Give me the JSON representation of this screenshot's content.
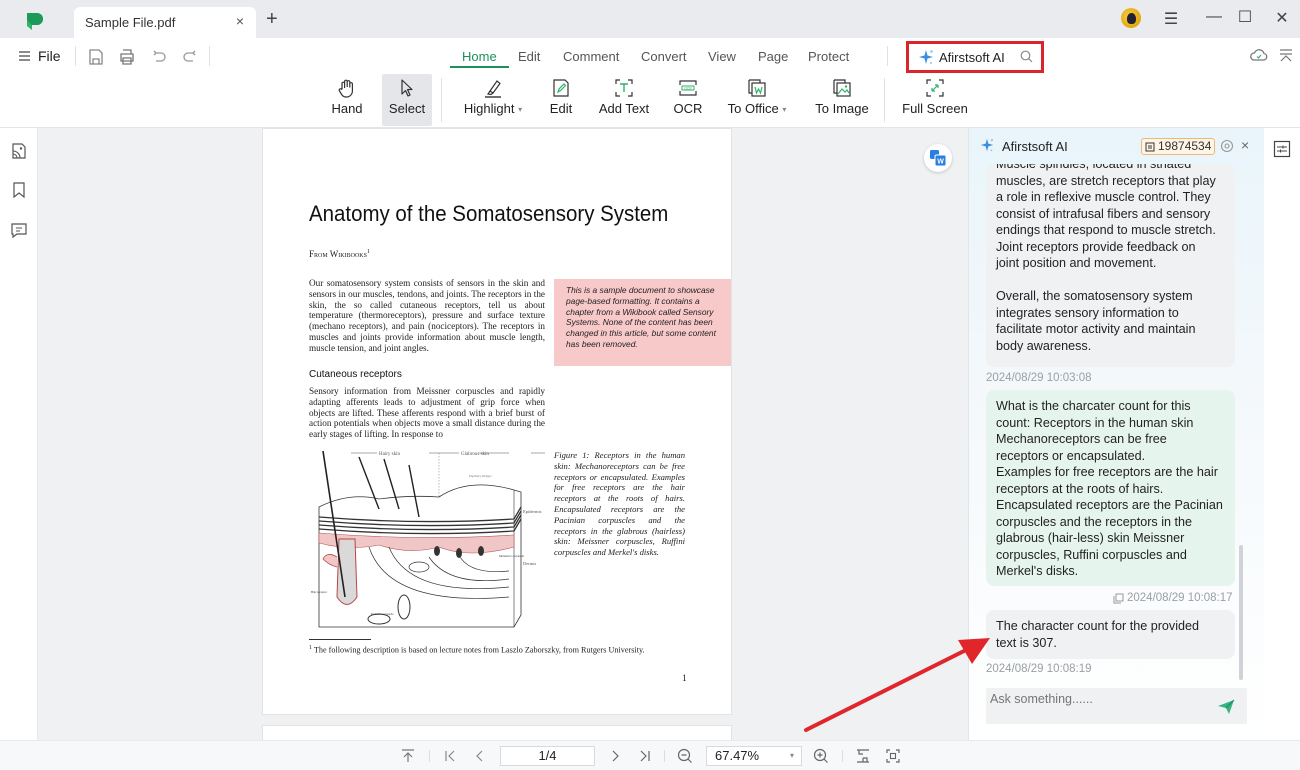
{
  "titlebar": {
    "tab_title": "Sample File.pdf",
    "tab_close": "×",
    "new_tab": "+",
    "window_controls": {
      "menu": "☰",
      "minimize": "—",
      "maximize": "☐",
      "close": "✕"
    }
  },
  "toolbar": {
    "file_label": "File",
    "menu_tabs": [
      "Home",
      "Edit",
      "Comment",
      "Convert",
      "View",
      "Page",
      "Protect"
    ],
    "active_tab": "Home",
    "ai_search_label": "Afirstsoft AI",
    "tools": [
      {
        "label": "Hand",
        "icon": "hand-icon"
      },
      {
        "label": "Select",
        "icon": "cursor-icon",
        "selected": true
      },
      {
        "label": "Highlight",
        "icon": "highlight-icon",
        "dropdown": true
      },
      {
        "label": "Edit",
        "icon": "edit-icon"
      },
      {
        "label": "Add Text",
        "icon": "add-text-icon"
      },
      {
        "label": "OCR",
        "icon": "ocr-icon"
      },
      {
        "label": "To Office",
        "icon": "to-office-icon",
        "dropdown": true
      },
      {
        "label": "To Image",
        "icon": "to-image-icon"
      },
      {
        "label": "Full Screen",
        "icon": "full-screen-icon"
      }
    ],
    "dropdown_caret": "▾",
    "accent_color": "#1d8f5e",
    "highlight_box_color": "#d9262c"
  },
  "document": {
    "title": "Anatomy of the Somatosensory System",
    "from_line": "From Wikibooks",
    "from_sup": "1",
    "intro": "Our somatosensory system consists of sensors in the skin and sensors in our muscles, tendons, and joints. The receptors in the skin, the so called cutaneous receptors, tell us about temperature (thermoreceptors), pressure and surface texture (mechano receptors), and pain (nociceptors). The receptors in muscles and joints provide information about muscle length, muscle tension, and joint angles.",
    "sidenote": "This is a sample document to showcase page-based formatting. It contains a chapter from a Wikibook called Sensory Systems. None of the content has been changed in this article, but some content has been removed.",
    "section_heading": "Cutaneous receptors",
    "section_text": "Sensory information from Meissner corpuscles and rapidly adapting afferents leads to adjustment of grip force when objects are lifted. These afferents respond with a brief burst of action potentials when objects move a small distance during the early stages of lifting. In response to",
    "figure_caption": "Figure 1: Receptors in the human skin: Mechanoreceptors can be free receptors or encapsulated. Examples for free receptors are the hair receptors at the roots of hairs. Encapsulated receptors are the Pacinian corpuscles and the receptors in the glabrous (hairless) skin: Meissner corpuscles, Ruffini corpuscles and Merkel's disks.",
    "figure_labels": {
      "hairy_skin": "Hairy skin",
      "glabrous_skin": "Glabrous skin",
      "epidermis": "Epidermis",
      "dermis": "Dermis",
      "papillary_ridges": "Papillary Ridges",
      "merkels": "Merkel's receptor",
      "free_nerve": "Free nerve ending",
      "sebaceous": "Sebaceous gland",
      "hair_receptor": "Hair receptor",
      "ruffini": "Ruffini's corpuscle",
      "meissner": "Meissner's corpuscle",
      "pacinian": "Pacinian corpuscle"
    },
    "footnote_mark": "1",
    "footnote": "The following description is based on lecture notes from Laszlo Zaborszky, from Rutgers University.",
    "page_number": "1",
    "sidenote_color": "#f8c9c9"
  },
  "ai_panel": {
    "title": "Afirstsoft AI",
    "credits": "19874534",
    "close": "×",
    "messages": [
      {
        "role": "ai",
        "text_lines": [
          "Muscle spindles, located in striated",
          "muscles, are stretch receptors that play",
          "a role in reflexive muscle control. They",
          "consist of intrafusal fibers and sensory",
          "endings that respond to muscle stretch.",
          "Joint receptors provide feedback on",
          "joint position and movement.",
          "",
          "Overall, the somatosensory system",
          "integrates sensory information to",
          "facilitate motor activity and maintain",
          "body awareness."
        ],
        "timestamp": "2024/08/29 10:03:08"
      },
      {
        "role": "user",
        "text_lines": [
          "What is the charcater count for this",
          "count: Receptors in the human skin",
          "Mechanoreceptors can be free",
          "receptors or encapsulated.",
          "Examples for free receptors are the hair",
          "receptors at the roots of hairs.",
          "Encapsulated receptors are the Pacinian",
          "corpuscles and the receptors in the",
          "glabrous (hair-less) skin Meissner",
          "corpuscles, Ruffini corpuscles and",
          "Merkel's disks."
        ],
        "timestamp": "2024/08/29 10:08:17"
      },
      {
        "role": "ai",
        "text_lines": [
          "The character count for the provided",
          "text is 307."
        ],
        "timestamp": "2024/08/29 10:08:19"
      }
    ],
    "input_placeholder": "Ask something......",
    "user_bubble_color": "#e6f4ee",
    "ai_bubble_color": "#eff1f3"
  },
  "bottom_bar": {
    "page_display": "1/4",
    "zoom_level": "67.47%",
    "zoom_caret": "▾"
  },
  "annotation": {
    "arrow_color": "#e0262b"
  }
}
